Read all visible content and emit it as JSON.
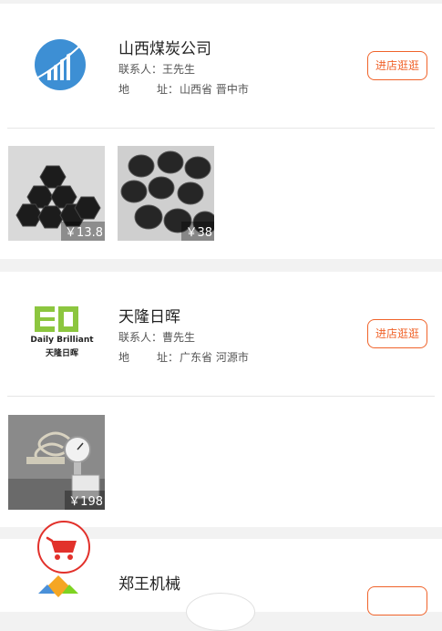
{
  "stores": [
    {
      "name": "山西煤炭公司",
      "contact_label": "联系人：",
      "contact_value": "王先生",
      "address_label_1": "地",
      "address_label_2": "址：",
      "address_value": "山西省 晋中市",
      "enter_button": "进店逛逛",
      "products": [
        {
          "price": "￥13.8"
        },
        {
          "price": "￥38"
        }
      ]
    },
    {
      "name": "天隆日晖",
      "logo_text_en": "Daily Brilliant",
      "logo_text_cn": "天隆日晖",
      "contact_label": "联系人：",
      "contact_value": "曹先生",
      "address_label_1": "地",
      "address_label_2": "址：",
      "address_value": "广东省 河源市",
      "enter_button": "进店逛逛",
      "products": [
        {
          "price": "￥198"
        }
      ]
    },
    {
      "name": "郑王机械"
    }
  ],
  "colors": {
    "accent": "#f0632a",
    "cart_red": "#e2312b",
    "page_bg": "#f2f2f2"
  },
  "icons": {
    "cart": "shopping-cart-icon"
  }
}
